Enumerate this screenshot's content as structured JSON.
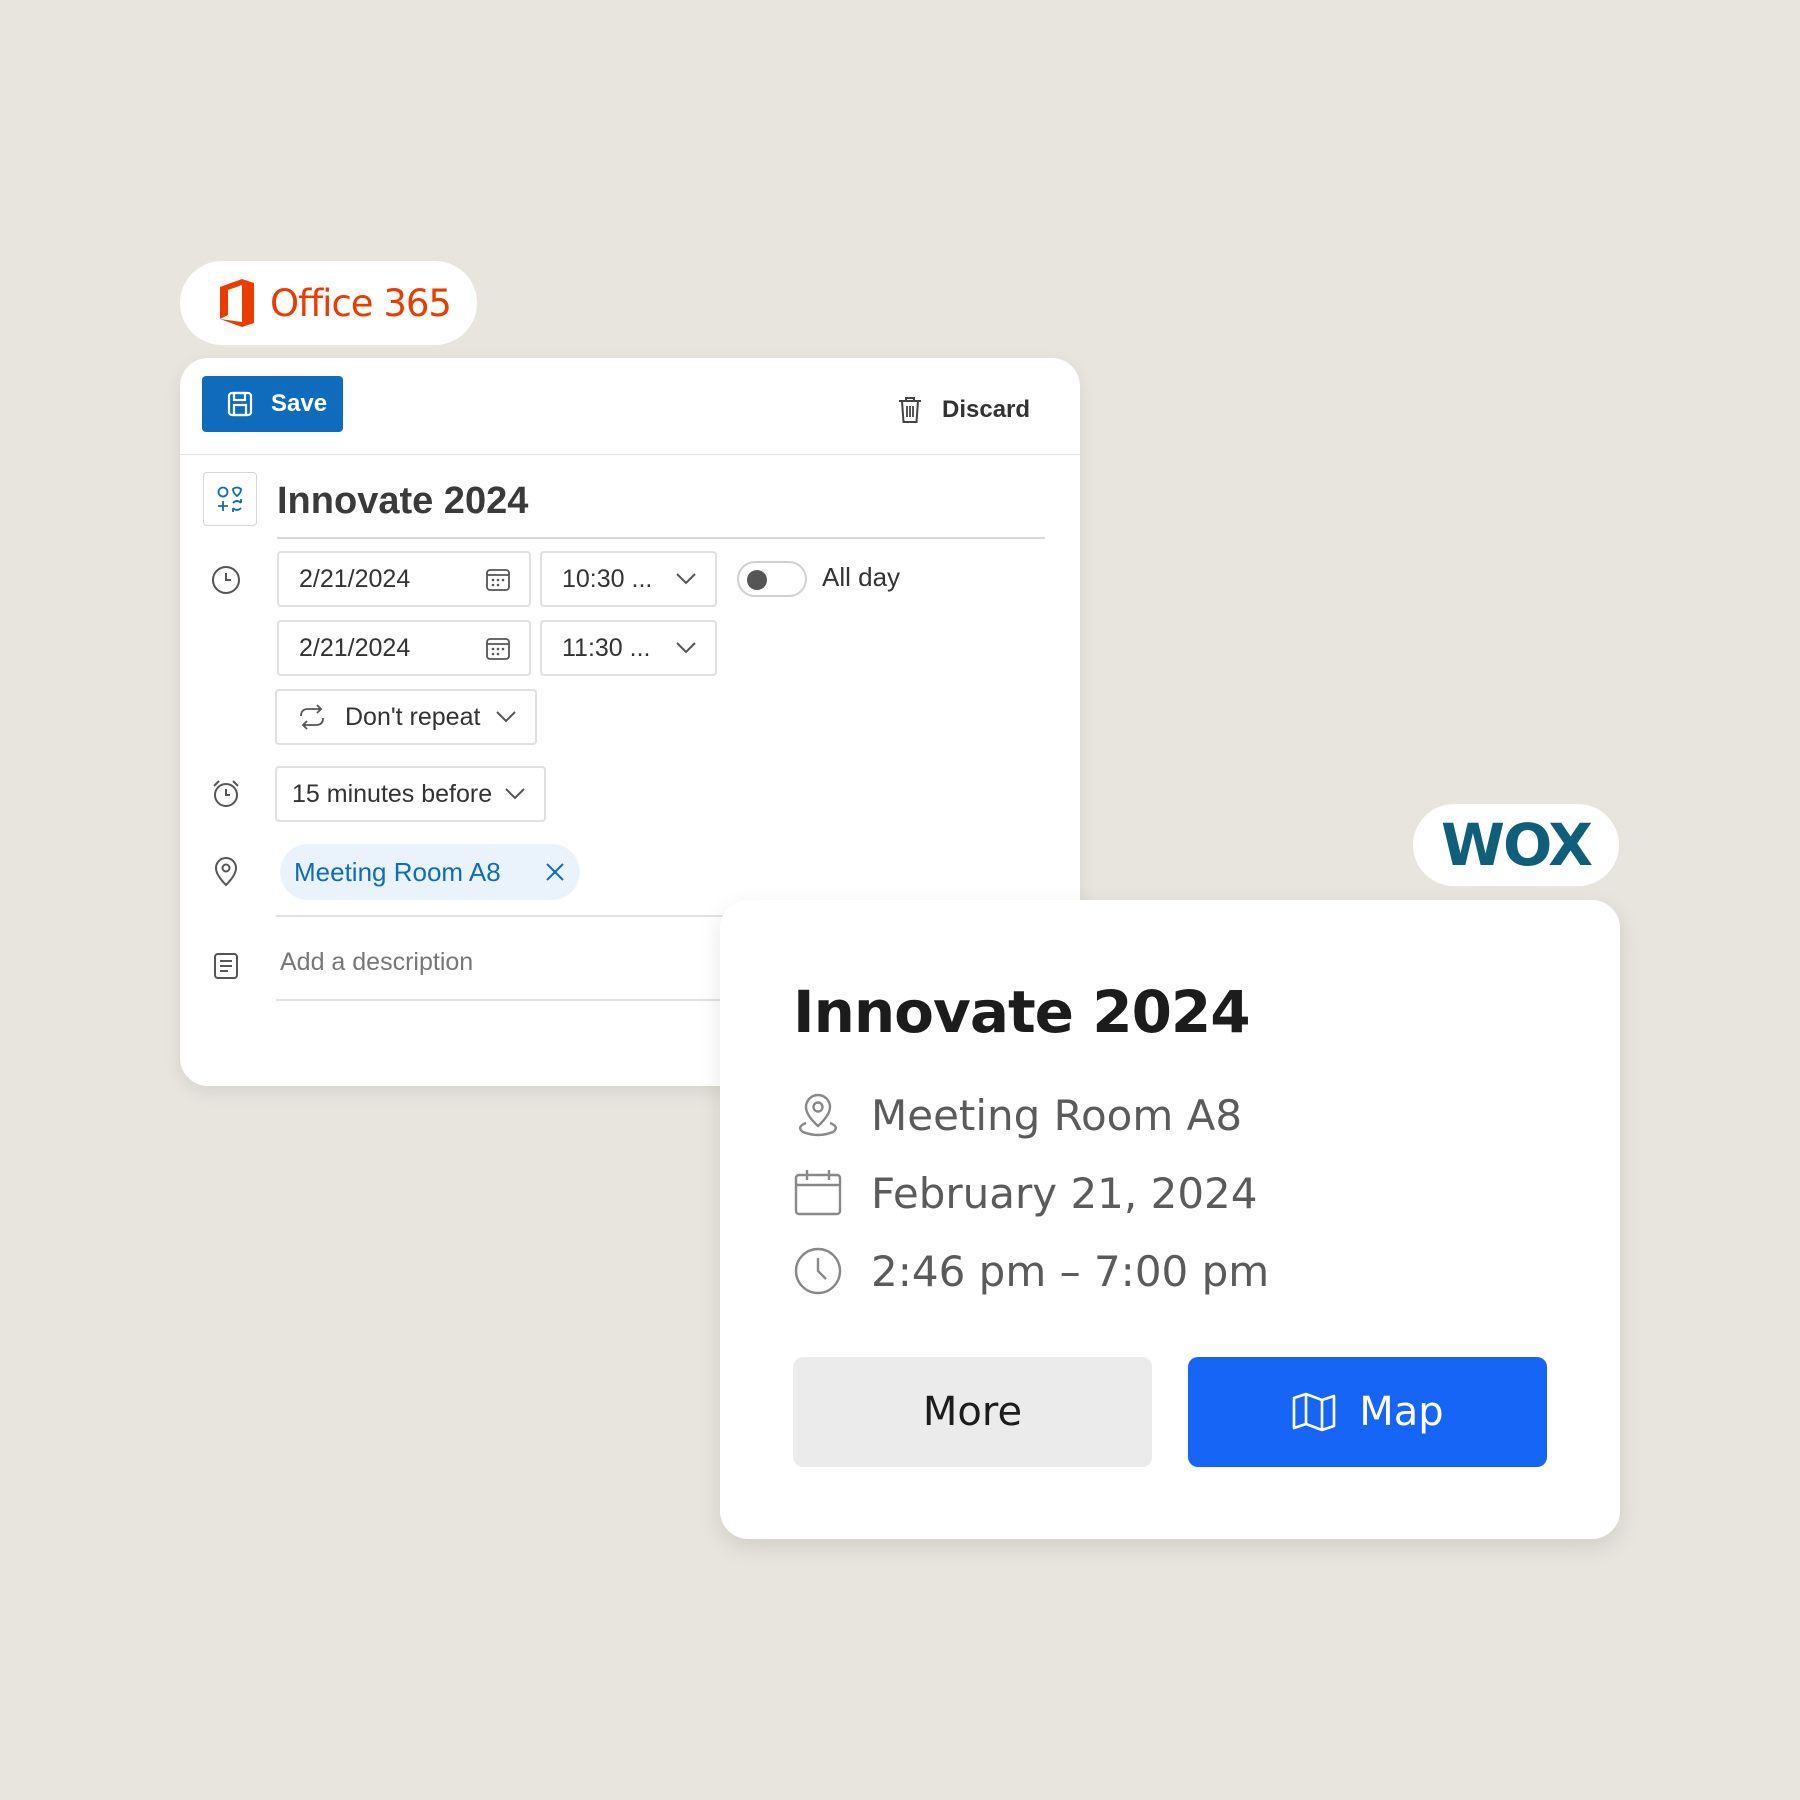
{
  "office365": {
    "brand_text": "Office 365",
    "brand_color": "#eb3c00"
  },
  "outlook": {
    "toolbar": {
      "save_label": "Save",
      "discard_label": "Discard"
    },
    "event_title": "Innovate 2024",
    "start": {
      "date": "2/21/2024",
      "time": "10:30 ..."
    },
    "end": {
      "date": "2/21/2024",
      "time": "11:30 ..."
    },
    "all_day_label": "All day",
    "all_day_enabled": false,
    "repeat_label": "Don't repeat",
    "reminder_label": "15 minutes before",
    "location_chip": "Meeting Room A8",
    "description_placeholder": "Add a description",
    "accent_color": "#0f6cbd"
  },
  "wox": {
    "brand_text": "WOX",
    "brand_color": "#0f5e7a",
    "event_title": "Innovate 2024",
    "location": "Meeting Room A8",
    "date": "February 21, 2024",
    "time_range": "2:46 pm – 7:00 pm",
    "more_label": "More",
    "map_label": "Map",
    "accent_color": "#1765f7"
  }
}
